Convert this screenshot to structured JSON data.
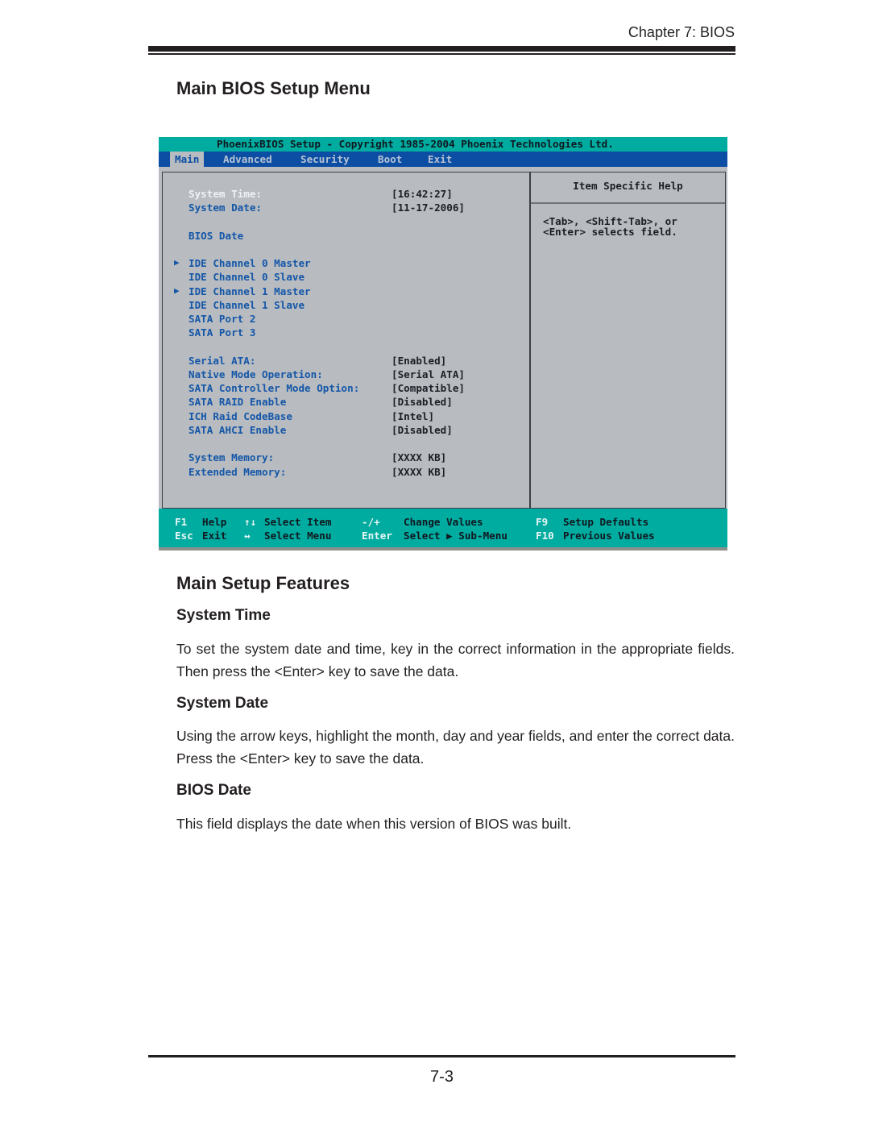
{
  "header": {
    "chapter": "Chapter 7: BIOS"
  },
  "section_title": "Main BIOS Setup Menu",
  "bios_screen": {
    "title": "PhoenixBIOS Setup - Copyright 1985-2004 Phoenix Technologies Ltd.",
    "menu_tabs": [
      {
        "label": "Main",
        "active": true
      },
      {
        "label": "Advanced",
        "active": false
      },
      {
        "label": "Security",
        "active": false
      },
      {
        "label": "Boot",
        "active": false
      },
      {
        "label": "Exit",
        "active": false
      }
    ],
    "items": [
      {
        "label": "System Time:",
        "value": "[16:42:27]",
        "selected": true,
        "submenu": false
      },
      {
        "label": "System Date:",
        "value": "[11-17-2006]",
        "selected": false,
        "submenu": false
      },
      {
        "label": "BIOS Date",
        "value": "",
        "selected": false,
        "submenu": false
      },
      {
        "label": "IDE Channel 0 Master",
        "value": "",
        "selected": false,
        "submenu": true
      },
      {
        "label": "IDE Channel 0 Slave",
        "value": "",
        "selected": false,
        "submenu": false
      },
      {
        "label": "IDE Channel 1 Master",
        "value": "",
        "selected": false,
        "submenu": true
      },
      {
        "label": "IDE Channel 1 Slave",
        "value": "",
        "selected": false,
        "submenu": false
      },
      {
        "label": "SATA Port 2",
        "value": "",
        "selected": false,
        "submenu": false
      },
      {
        "label": "SATA Port 3",
        "value": "",
        "selected": false,
        "submenu": false
      },
      {
        "label": "Serial ATA:",
        "value": "[Enabled]",
        "selected": false,
        "submenu": false
      },
      {
        "label": "Native Mode Operation:",
        "value": "[Serial ATA]",
        "selected": false,
        "submenu": false
      },
      {
        "label": "SATA Controller Mode Option:",
        "value": "[Compatible]",
        "selected": false,
        "submenu": false
      },
      {
        "label": "SATA RAID Enable",
        "value": "[Disabled]",
        "selected": false,
        "submenu": false
      },
      {
        "label": "ICH Raid CodeBase",
        "value": "[Intel]",
        "selected": false,
        "submenu": false
      },
      {
        "label": "SATA AHCI Enable",
        "value": "[Disabled]",
        "selected": false,
        "submenu": false
      },
      {
        "label": "System Memory:",
        "value": "[XXXX KB]",
        "selected": false,
        "submenu": false
      },
      {
        "label": "Extended Memory:",
        "value": "[XXXX KB]",
        "selected": false,
        "submenu": false
      }
    ],
    "help": {
      "title": "Item Specific Help",
      "lines": [
        "<Tab>, <Shift-Tab>, or",
        "<Enter> selects field."
      ]
    },
    "footer": {
      "row1": [
        {
          "key": "F1",
          "desc": "Help"
        },
        {
          "key": "↑↓",
          "desc": "Select Item"
        },
        {
          "key": "-/+",
          "desc": "Change Values"
        },
        {
          "key": "F9",
          "desc": "Setup Defaults"
        }
      ],
      "row2": [
        {
          "key": "Esc",
          "desc": "Exit"
        },
        {
          "key": "↔",
          "desc": "Select Menu"
        },
        {
          "key": "Enter",
          "desc": "Select ▶ Sub-Menu"
        },
        {
          "key": "F10",
          "desc": "Previous Values"
        }
      ]
    },
    "arrow_glyph": "▶"
  },
  "features": {
    "title": "Main Setup Features",
    "system_time": {
      "heading": "System Time",
      "text": "To set the system date and time, key in the correct information in the appropriate fields.  Then press the <Enter> key to save the data."
    },
    "system_date": {
      "heading": "System Date",
      "text": "Using the arrow keys, highlight the month, day and year fields, and enter the correct data.  Press the <Enter> key to save the data."
    },
    "bios_date": {
      "heading": "BIOS Date",
      "text": "This field displays the date when this version of BIOS was built."
    }
  },
  "footer": {
    "page_number": "7-3"
  }
}
